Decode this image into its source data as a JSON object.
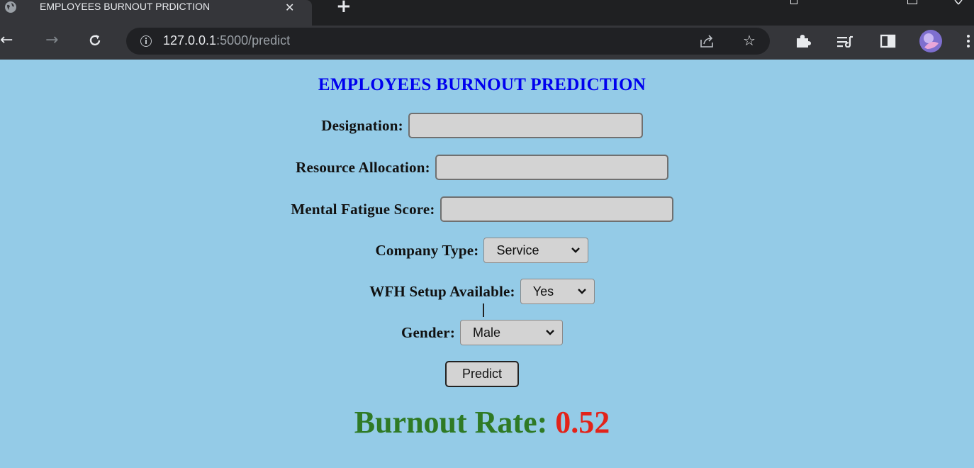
{
  "browser": {
    "tab_title": "EMPLOYEES BURNOUT PRDICTION",
    "tab_close": "✕",
    "new_tab": "+",
    "url_host": "127.0.0.1",
    "url_path": ":5000/predict",
    "icons": [
      "globe-icon",
      "close-icon",
      "plus-icon",
      "back-icon",
      "forward-icon",
      "reload-icon",
      "info-icon",
      "share-icon",
      "star-icon",
      "extensions-icon",
      "reading-list-icon",
      "side-panel-icon",
      "profile-avatar",
      "menu-icon"
    ]
  },
  "page": {
    "title": "EMPLOYEES BURNOUT PREDICTION",
    "fields": {
      "designation": {
        "label": "Designation:",
        "value": ""
      },
      "resource_allocation": {
        "label": "Resource Allocation:",
        "value": ""
      },
      "mental_fatigue_score": {
        "label": "Mental Fatigue Score:",
        "value": ""
      },
      "company_type": {
        "label": "Company Type:",
        "selected": "Service"
      },
      "wfh_setup": {
        "label": "WFH Setup Available:",
        "selected": "Yes"
      },
      "gender": {
        "label": "Gender:",
        "selected": "Male"
      }
    },
    "predict_label": "Predict",
    "result": {
      "label": "Burnout Rate:",
      "value": "0.52"
    }
  },
  "colors": {
    "page_background": "#94cbe7",
    "title": "#0000ee",
    "result_label": "#2f7a25",
    "result_value": "#e2231a"
  }
}
